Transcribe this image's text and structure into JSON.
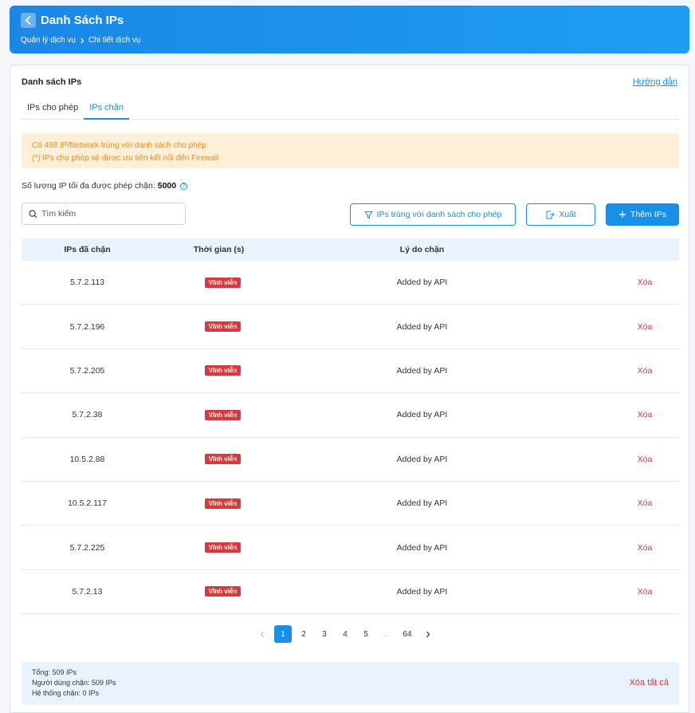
{
  "header": {
    "title": "Danh Sách IPs",
    "breadcrumb": [
      "Quản lý dịch vụ",
      "Chi tiết dịch vụ"
    ]
  },
  "card": {
    "title": "Danh sách IPs",
    "guide_link": "Hướng dẫn",
    "tabs": [
      {
        "label": "IPs cho phép",
        "active": false
      },
      {
        "label": "IPs chặn",
        "active": true
      }
    ],
    "notice": {
      "line1": "Có 498 IP/Network trùng với danh sách cho phép",
      "line2": "(*) IPs cho phép sẽ được ưu tiên kết nối đến Firewall"
    },
    "limit_label": "Số lượng IP tối đa được phép chặn:",
    "limit_value": "5000",
    "search_placeholder": "Tìm kiếm",
    "buttons": {
      "duplicate": "IPs trùng với danh sách cho phép",
      "export": "Xuất",
      "add": "Thêm IPs"
    }
  },
  "table": {
    "headers": [
      "IPs đã chặn",
      "Thời gian (s)",
      "Lý do chặn",
      ""
    ],
    "rows": [
      {
        "ip": "5.7.2.113",
        "time": "Vĩnh viễn",
        "reason": "Added by API",
        "action": "Xóa"
      },
      {
        "ip": "5.7.2.196",
        "time": "Vĩnh viễn",
        "reason": "Added by API",
        "action": "Xóa"
      },
      {
        "ip": "5.7.2.205",
        "time": "Vĩnh viễn",
        "reason": "Added by API",
        "action": "Xóa"
      },
      {
        "ip": "5.7.2.38",
        "time": "Vĩnh viễn",
        "reason": "Added by API",
        "action": "Xóa"
      },
      {
        "ip": "10.5.2.88",
        "time": "Vĩnh viễn",
        "reason": "Added by API",
        "action": "Xóa"
      },
      {
        "ip": "10.5.2.117",
        "time": "Vĩnh viễn",
        "reason": "Added by API",
        "action": "Xóa"
      },
      {
        "ip": "5.7.2.225",
        "time": "Vĩnh viễn",
        "reason": "Added by API",
        "action": "Xóa"
      },
      {
        "ip": "5.7.2.13",
        "time": "Vĩnh viễn",
        "reason": "Added by API",
        "action": "Xóa"
      }
    ]
  },
  "pagination": {
    "pages": [
      "1",
      "2",
      "3",
      "4",
      "5",
      "...",
      "64"
    ],
    "current": "1"
  },
  "footer": {
    "total": "Tổng: 509 IPs",
    "user_blocked": "Người dùng chặn: 509 IPs",
    "system_blocked": "Hệ thống chặn: 0 IPs",
    "delete_all": "Xóa tất cả"
  },
  "colors": {
    "primary": "#1890e8",
    "danger": "#e0313f",
    "badge": "#d8393b",
    "notice_bg": "#feefd9",
    "notice_text": "#f08c1a"
  },
  "icons": {
    "back": "chevron-left-icon",
    "breadcrumb_sep": "chevron-right-icon",
    "search": "search-icon",
    "filter": "filter-icon",
    "export": "export-icon",
    "add": "plus-icon",
    "info": "info-icon"
  }
}
